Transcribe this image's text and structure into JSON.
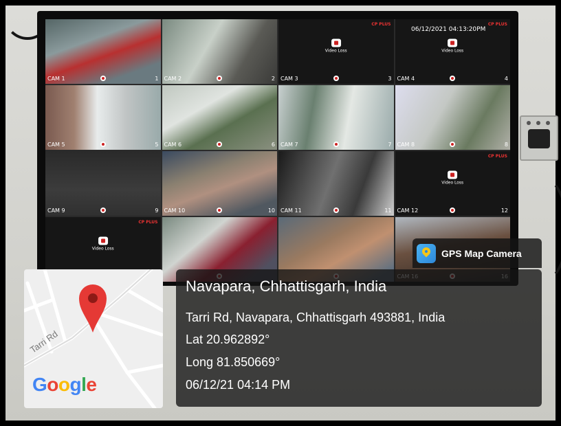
{
  "cameras": [
    {
      "label": "CAM 1",
      "num": "1",
      "feed": "f1"
    },
    {
      "label": "CAM 2",
      "num": "2",
      "feed": "f2"
    },
    {
      "label": "CAM 3",
      "num": "3",
      "feed": "loss"
    },
    {
      "label": "CAM 4",
      "num": "4",
      "feed": "loss"
    },
    {
      "label": "CAM 5",
      "num": "5",
      "feed": "f5"
    },
    {
      "label": "CAM 6",
      "num": "6",
      "feed": "f6"
    },
    {
      "label": "CAM 7",
      "num": "7",
      "feed": "f7"
    },
    {
      "label": "CAM 8",
      "num": "8",
      "feed": "f8"
    },
    {
      "label": "CAM 9",
      "num": "9",
      "feed": "f9"
    },
    {
      "label": "CAM 10",
      "num": "10",
      "feed": "f10"
    },
    {
      "label": "CAM 11",
      "num": "11",
      "feed": "f11"
    },
    {
      "label": "CAM 12",
      "num": "12",
      "feed": "loss"
    },
    {
      "label": "",
      "num": "",
      "feed": "loss"
    },
    {
      "label": "",
      "num": "",
      "feed": "f14"
    },
    {
      "label": "",
      "num": "",
      "feed": "f15"
    },
    {
      "label": "CAM 16",
      "num": "16",
      "feed": "f16"
    }
  ],
  "brand_text": "CP PLUS",
  "video_loss_text": "Video Loss",
  "dvr_timestamp": "06/12/2021 04:13:20PM",
  "gps_app_name": "GPS Map Camera",
  "location": {
    "title": "Navapara, Chhattisgarh, India",
    "address": "Tarri Rd, Navapara, Chhattisgarh 493881, India",
    "lat": "Lat 20.962892°",
    "long": "Long 81.850669°",
    "datetime": "06/12/21 04:14 PM"
  },
  "map": {
    "road_label": "Tarri Rd",
    "provider_logo_text": "Google",
    "pin_color": "#e53935"
  }
}
